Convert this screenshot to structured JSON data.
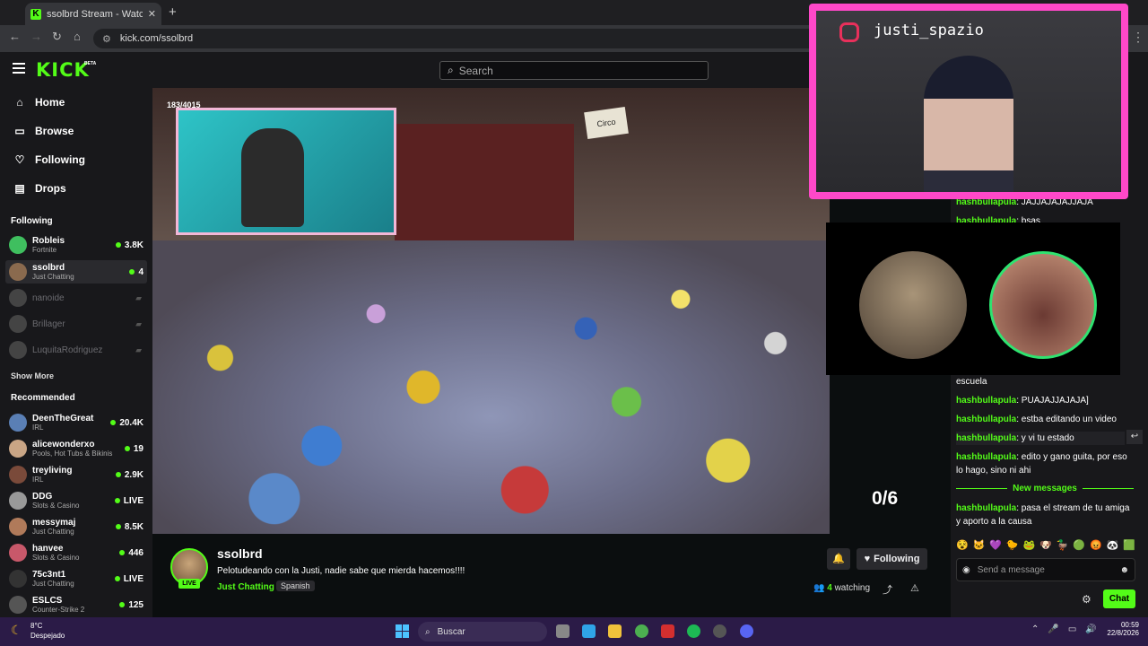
{
  "browser": {
    "tab_title": "ssolbrd Stream - Watch Live on",
    "tab_close": "✕",
    "new_tab": "+",
    "url": "kick.com/ssolbrd",
    "menu": "⋮"
  },
  "header": {
    "logo": "KICK",
    "logo_badge": "BETA",
    "search_placeholder": "Search"
  },
  "sidebar": {
    "nav": [
      {
        "label": "Home",
        "icon": "home-icon"
      },
      {
        "label": "Browse",
        "icon": "browse-icon"
      },
      {
        "label": "Following",
        "icon": "heart-icon"
      },
      {
        "label": "Drops",
        "icon": "drops-icon"
      }
    ],
    "following_title": "Following",
    "following": [
      {
        "name": "Robleis",
        "category": "Fortnite",
        "viewers": "3.8K",
        "color": "#3fbf5f"
      },
      {
        "name": "ssolbrd",
        "category": "Just Chatting",
        "viewers": "4",
        "color": "#8a6a4e"
      },
      {
        "name": "nanoide",
        "category": "",
        "viewers": "",
        "color": "#444"
      },
      {
        "name": "Brillager",
        "category": "",
        "viewers": "",
        "color": "#444"
      },
      {
        "name": "LuquitaRodriguez",
        "category": "",
        "viewers": "",
        "color": "#444"
      }
    ],
    "show_more": "Show More",
    "recommended_title": "Recommended",
    "recommended": [
      {
        "name": "DeenTheGreat",
        "category": "IRL",
        "viewers": "20.4K",
        "color": "#5a7fb5"
      },
      {
        "name": "alicewonderxo",
        "category": "Pools, Hot Tubs & Bikinis",
        "viewers": "19",
        "color": "#c9a585"
      },
      {
        "name": "treyliving",
        "category": "IRL",
        "viewers": "2.9K",
        "color": "#7a4a3a"
      },
      {
        "name": "DDG",
        "category": "Slots & Casino",
        "viewers": "LIVE",
        "color": "#999"
      },
      {
        "name": "messymaj",
        "category": "Just Chatting",
        "viewers": "8.5K",
        "color": "#b07a5a"
      },
      {
        "name": "hanvee",
        "category": "Slots & Casino",
        "viewers": "446",
        "color": "#c8586a"
      },
      {
        "name": "75c3nt1",
        "category": "Just Chatting",
        "viewers": "LIVE",
        "color": "#333"
      },
      {
        "name": "ESLCS",
        "category": "Counter-Strike 2",
        "viewers": "125",
        "color": "#555"
      }
    ]
  },
  "video": {
    "overlay_count": "183/4015",
    "sign_text": "Circo",
    "progress": "0/6"
  },
  "stream": {
    "streamer": "ssolbrd",
    "live": "LIVE",
    "title": "Pelotudeando con la Justi, nadie sabe que mierda hacemos!!!!",
    "category": "Just Chatting",
    "language": "Spanish",
    "following_label": "Following",
    "watching_count": "4",
    "watching_label": "watching"
  },
  "chat": {
    "messages": [
      {
        "user": "hashbullapula",
        "text": "JAJJAJAJAJJAJA"
      },
      {
        "user": "hashbullapula",
        "text": "bsas"
      },
      {
        "user": "",
        "text": "escuela"
      },
      {
        "user": "hashbullapula",
        "text": "PUAJAJJAJAJA]"
      },
      {
        "user": "hashbullapula",
        "text": "estba editando un video"
      },
      {
        "user": "hashbullapula",
        "text": "y vi tu estado"
      },
      {
        "user": "hashbullapula",
        "text": "edito y gano guita, por eso lo hago, sino ni ahi"
      },
      {
        "user": "hashbullapula",
        "text": "pasa el stream de tu amiga y aporto a la causa"
      }
    ],
    "new_messages": "New messages",
    "send_placeholder": "Send a message",
    "chat_button": "Chat"
  },
  "overlay": {
    "instagram_handle": "justi_spazio"
  },
  "taskbar": {
    "temperature": "8°C",
    "weather": "Despejado",
    "search": "Buscar",
    "time": "00:59",
    "date": "22/8/2026"
  }
}
